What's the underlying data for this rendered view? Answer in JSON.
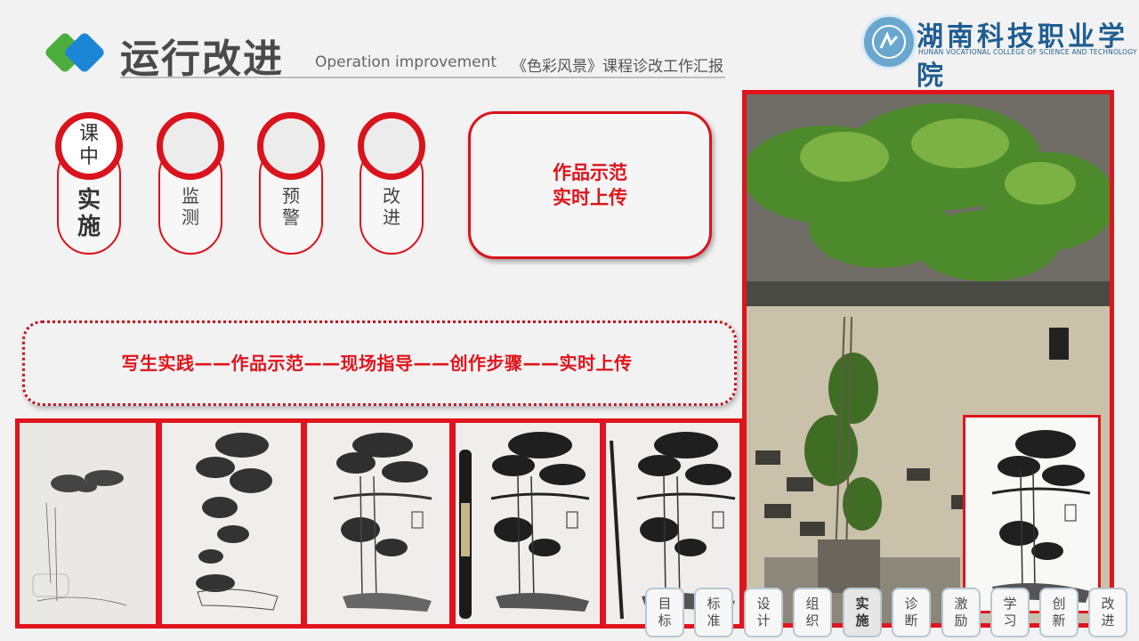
{
  "header": {
    "title": "运行改进",
    "subtitle_en": "Operation improvement",
    "subtitle_cn": "《色彩风景》课程诊改工作汇报",
    "school_name_cn": "湖南科技职业学院",
    "school_name_en": "HUNAN VOCATIONAL COLLEGE OF SCIENCE AND TECHNOLOGY"
  },
  "steps": [
    {
      "top": "课中",
      "bottom": "实施"
    },
    {
      "top": "",
      "bottom": "监测"
    },
    {
      "top": "",
      "bottom": "预警"
    },
    {
      "top": "",
      "bottom": "改进"
    }
  ],
  "demo_box": {
    "line1": "作品示范",
    "line2": "实时上传"
  },
  "process_flow": "写生实践——作品示范——现场指导——创作步骤——实时上传",
  "nav": [
    {
      "l1": "目",
      "l2": "标"
    },
    {
      "l1": "标",
      "l2": "准"
    },
    {
      "l1": "设",
      "l2": "计"
    },
    {
      "l1": "组",
      "l2": "织"
    },
    {
      "l1": "实",
      "l2": "施"
    },
    {
      "l1": "诊",
      "l2": "断"
    },
    {
      "l1": "激",
      "l2": "励"
    },
    {
      "l1": "学",
      "l2": "习"
    },
    {
      "l1": "创",
      "l2": "新"
    },
    {
      "l1": "改",
      "l2": "进"
    }
  ],
  "nav_active": "实施",
  "colors": {
    "accent_red": "#e0141c",
    "logo_green": "#4cae3c",
    "logo_blue": "#1b86d6"
  }
}
